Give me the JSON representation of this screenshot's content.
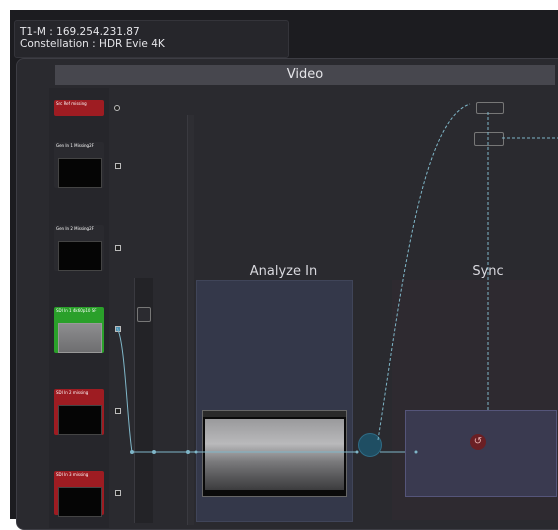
{
  "info": {
    "line1": "T1-M : 169.254.231.87",
    "line2": "Constellation : HDR Evie 4K"
  },
  "groups": {
    "video": "Video",
    "analyze_in": "Analyze In",
    "sync": "Sync"
  },
  "sources": [
    {
      "header": "Src Ref\nmissing",
      "color": "#9e1c22",
      "state": "missing",
      "has_thumb": false
    },
    {
      "header": "Gen In 1\nMissing2F",
      "color": "#2a2a2f",
      "state": "missing",
      "has_thumb": true
    },
    {
      "header": "Gen In 2\nMissing2F",
      "color": "#2a2a2f",
      "state": "missing",
      "has_thumb": true
    },
    {
      "header": "SDI In 1\n4k60p10 SF",
      "color": "#2aa02a",
      "state": "active",
      "has_thumb": true
    },
    {
      "header": "SDI In 2\nmissing",
      "color": "#9e1c22",
      "state": "missing",
      "has_thumb": true
    },
    {
      "header": "SDI In 3\nmissing",
      "color": "#9e1c22",
      "state": "missing",
      "has_thumb": true
    }
  ],
  "colors": {
    "connection": "#7fb6c8",
    "missing": "#9e1c22",
    "active": "#2aa02a",
    "analyze_bg": "#34384a"
  }
}
